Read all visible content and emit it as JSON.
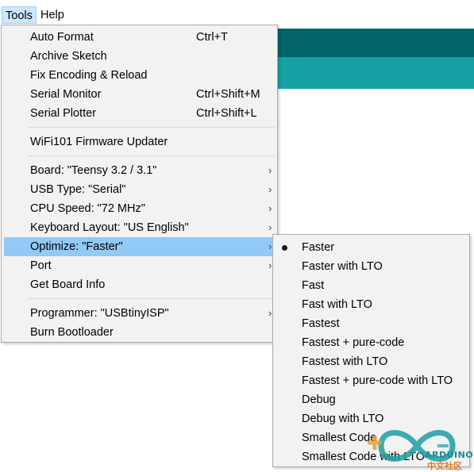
{
  "menubar": {
    "items": [
      {
        "label": "Tools"
      },
      {
        "label": "Help"
      }
    ]
  },
  "tools_menu": {
    "items": [
      {
        "label": "Auto Format",
        "shortcut": "Ctrl+T"
      },
      {
        "label": "Archive Sketch",
        "shortcut": ""
      },
      {
        "label": "Fix Encoding & Reload",
        "shortcut": ""
      },
      {
        "label": "Serial Monitor",
        "shortcut": "Ctrl+Shift+M"
      },
      {
        "label": "Serial Plotter",
        "shortcut": "Ctrl+Shift+L"
      },
      {
        "label": "WiFi101 Firmware Updater",
        "shortcut": ""
      },
      {
        "label": "Board: \"Teensy 3.2 / 3.1\"",
        "submenu": true
      },
      {
        "label": "USB Type: \"Serial\"",
        "submenu": true
      },
      {
        "label": "CPU Speed: \"72 MHz\"",
        "submenu": true
      },
      {
        "label": "Keyboard Layout: \"US English\"",
        "submenu": true
      },
      {
        "label": "Optimize: \"Faster\"",
        "submenu": true,
        "highlighted": true
      },
      {
        "label": "Port",
        "submenu": true
      },
      {
        "label": "Get Board Info",
        "shortcut": ""
      },
      {
        "label": "Programmer: \"USBtinyISP\"",
        "submenu": true
      },
      {
        "label": "Burn Bootloader",
        "shortcut": ""
      }
    ],
    "arrow_glyph": "›"
  },
  "optimize_submenu": {
    "selected": "Faster",
    "items": [
      {
        "label": "Faster"
      },
      {
        "label": "Faster with LTO"
      },
      {
        "label": "Fast"
      },
      {
        "label": "Fast with LTO"
      },
      {
        "label": "Fastest"
      },
      {
        "label": "Fastest + pure-code"
      },
      {
        "label": "Fastest with LTO"
      },
      {
        "label": "Fastest + pure-code with LTO"
      },
      {
        "label": "Debug"
      },
      {
        "label": "Debug with LTO"
      },
      {
        "label": "Smallest Code"
      },
      {
        "label": "Smallest Code with LTO"
      }
    ]
  },
  "watermark": {
    "brand": "ARDUINO",
    "subtitle": "中文社区",
    "icon": "arduino-infinity-logo"
  },
  "colors": {
    "highlight": "#91c9f7",
    "menu_bg": "#f2f2f2",
    "teal_dark": "#006468",
    "teal_light": "#17a1a5",
    "menubar_active": "#cce8ff"
  }
}
